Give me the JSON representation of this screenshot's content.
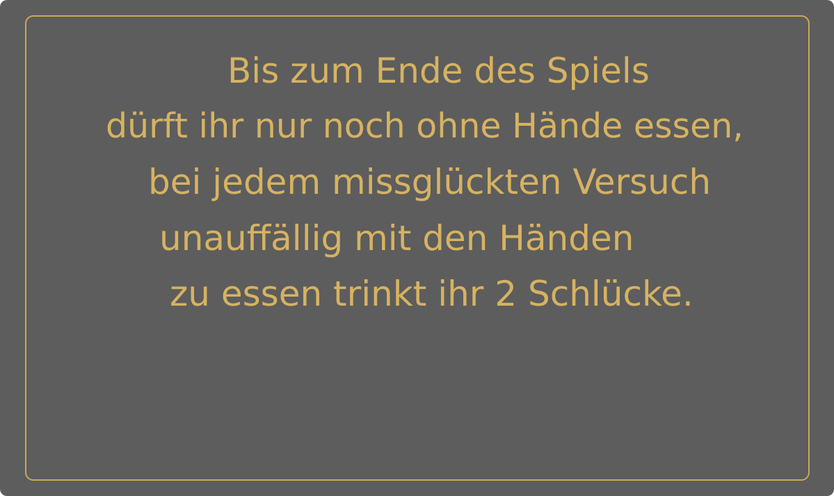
{
  "card": {
    "colors": {
      "background": "#5d5d5d",
      "border": "#c9a95a",
      "text": "#d6b362"
    },
    "lines": [
      "Bis zum Ende des Spiels",
      "dürft ihr nur noch ohne Hände essen,",
      "bei jedem missglückten Versuch",
      "unauffällig mit den Händen",
      "zu essen trinkt ihr 2 Schlücke."
    ]
  }
}
